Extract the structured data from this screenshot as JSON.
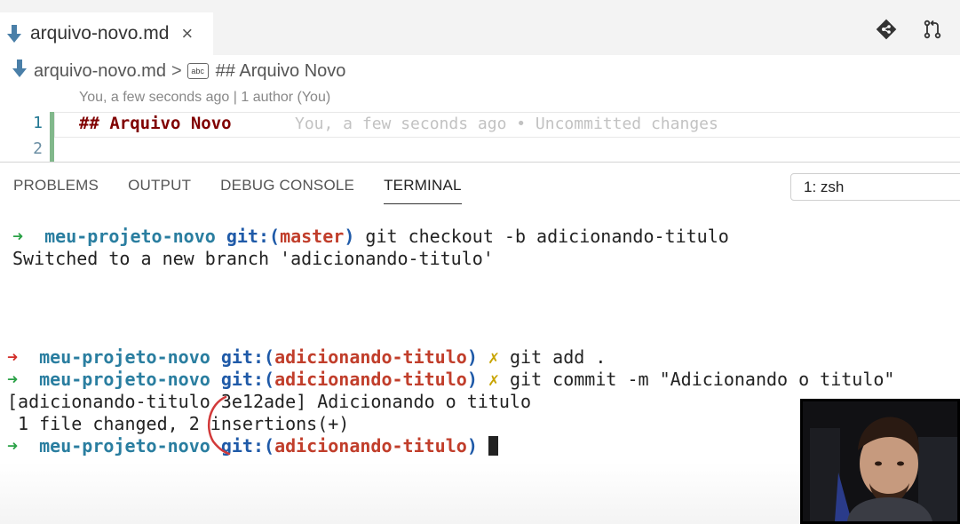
{
  "tab": {
    "label": "arquivo-novo.md",
    "close_glyph": "×"
  },
  "tabbar_actions": [
    {
      "icon": "git-compare-icon"
    },
    {
      "icon": "pull-request-icon"
    }
  ],
  "breadcrumb": {
    "file": "arquivo-novo.md",
    "separator": ">",
    "symbol_icon_text": "abc",
    "symbol": "## Arquivo Novo"
  },
  "codelens": "You, a few seconds ago | 1 author (You)",
  "editor": {
    "lines": [
      {
        "number": "1",
        "text": "## Arquivo Novo",
        "annotation": "You, a few seconds ago • Uncommitted changes"
      },
      {
        "number": "2",
        "text": ""
      }
    ]
  },
  "panel": {
    "tabs": [
      "PROBLEMS",
      "OUTPUT",
      "DEBUG CONSOLE",
      "TERMINAL"
    ],
    "active_tab": "TERMINAL",
    "terminal_select": "1: zsh"
  },
  "terminal": {
    "line1": {
      "arrow": "➜",
      "dir": "meu-projeto-novo",
      "git": "git:(",
      "branch": "master",
      "close": ")",
      "cmd": " git checkout -b adicionando-titulo"
    },
    "line2": "Switched to a new branch 'adicionando-titulo'",
    "line3": {
      "arrow": "➜",
      "dir": "meu-projeto-novo",
      "git": "git:(",
      "branch": "adicionando-titulo",
      "close": ")",
      "x": "✗",
      "cmd": " git add ."
    },
    "line4": {
      "arrow": "➜",
      "dir": "meu-projeto-novo",
      "git": "git:(",
      "branch": "adicionando-titulo",
      "close": ")",
      "x": "✗",
      "cmd": " git commit -m \"Adicionando o titulo\""
    },
    "line5": "[adicionando-titulo 3e12ade] Adicionando o titulo",
    "line6": " 1 file changed, 2 insertions(+)",
    "line7": {
      "arrow": "➜",
      "dir": "meu-projeto-novo",
      "git": "git:(",
      "branch": "adicionando-titulo",
      "close": ")"
    }
  },
  "colors": {
    "prompt_arrow_ok": "#2aa146",
    "prompt_arrow_err": "#d22d28",
    "dir": "#2a7ea0",
    "git": "#1f5aa8",
    "branch": "#c13e2b",
    "dirty": "#c8a400",
    "heading": "#800000",
    "git_added_bar": "#81b88b"
  }
}
